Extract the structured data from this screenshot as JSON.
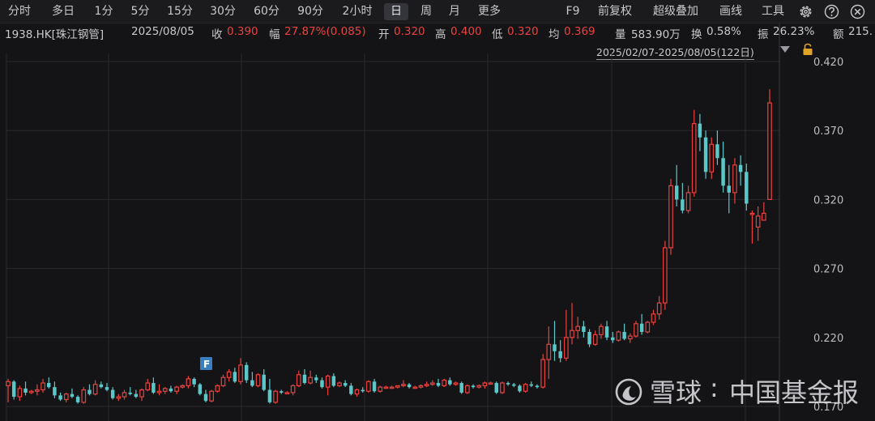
{
  "toolbar": {
    "periods": [
      "分时",
      "多日",
      "1分",
      "5分",
      "15分",
      "30分",
      "60分",
      "90分",
      "2小时",
      "日",
      "周",
      "月",
      "更多"
    ],
    "active_period": "日",
    "right_items": [
      "F9",
      "前复权",
      "超级叠加",
      "画线",
      "工具"
    ],
    "icons": [
      "gear-icon",
      "help-icon",
      "close-icon"
    ]
  },
  "quote": {
    "symbol": "1938.HK[珠江钢管]",
    "date": "2025/08/05",
    "close_label": "收",
    "close": "0.390",
    "change_label": "幅",
    "change": "27.87%(0.085)",
    "open_label": "开",
    "open": "0.320",
    "high_label": "高",
    "high": "0.400",
    "low_label": "低",
    "low": "0.320",
    "avg_label": "均",
    "avg": "0.369",
    "volume_label": "量",
    "volume": "583.90万",
    "turnover_label": "换",
    "turnover": "0.58%",
    "amplitude_label": "振",
    "amplitude": "26.23%",
    "amount_label": "额",
    "amount": "215."
  },
  "range": {
    "label": "2025/02/07-2025/08/05(122日)"
  },
  "chart_data": {
    "type": "candlestick",
    "y_ticks": [
      "0.420",
      "0.370",
      "0.320",
      "0.270",
      "0.220",
      "0.170"
    ],
    "ylim": [
      0.17,
      0.43
    ],
    "num_candles": 122,
    "up_color": "#e8423f",
    "down_color": "#5cc7c9",
    "grid": true,
    "marker_label": "F",
    "candles": [
      [
        0.185,
        0.19,
        0.173,
        0.188
      ],
      [
        0.188,
        0.189,
        0.175,
        0.177
      ],
      [
        0.177,
        0.185,
        0.174,
        0.183
      ],
      [
        0.183,
        0.188,
        0.178,
        0.18
      ],
      [
        0.18,
        0.182,
        0.179,
        0.181
      ],
      [
        0.181,
        0.186,
        0.178,
        0.182
      ],
      [
        0.182,
        0.19,
        0.18,
        0.187
      ],
      [
        0.187,
        0.191,
        0.183,
        0.184
      ],
      [
        0.184,
        0.188,
        0.176,
        0.178
      ],
      [
        0.178,
        0.18,
        0.174,
        0.175
      ],
      [
        0.175,
        0.18,
        0.173,
        0.179
      ],
      [
        0.179,
        0.183,
        0.176,
        0.177
      ],
      [
        0.177,
        0.178,
        0.172,
        0.173
      ],
      [
        0.173,
        0.184,
        0.172,
        0.182
      ],
      [
        0.182,
        0.186,
        0.178,
        0.179
      ],
      [
        0.179,
        0.189,
        0.178,
        0.186
      ],
      [
        0.186,
        0.188,
        0.183,
        0.184
      ],
      [
        0.184,
        0.187,
        0.181,
        0.182
      ],
      [
        0.182,
        0.184,
        0.175,
        0.176
      ],
      [
        0.176,
        0.179,
        0.174,
        0.177
      ],
      [
        0.177,
        0.182,
        0.175,
        0.18
      ],
      [
        0.18,
        0.184,
        0.178,
        0.179
      ],
      [
        0.179,
        0.182,
        0.176,
        0.177
      ],
      [
        0.177,
        0.183,
        0.174,
        0.182
      ],
      [
        0.182,
        0.19,
        0.181,
        0.187
      ],
      [
        0.187,
        0.191,
        0.179,
        0.18
      ],
      [
        0.18,
        0.186,
        0.178,
        0.181
      ],
      [
        0.181,
        0.184,
        0.179,
        0.183
      ],
      [
        0.183,
        0.185,
        0.18,
        0.181
      ],
      [
        0.181,
        0.185,
        0.179,
        0.184
      ],
      [
        0.184,
        0.186,
        0.183,
        0.185
      ],
      [
        0.185,
        0.192,
        0.183,
        0.19
      ],
      [
        0.19,
        0.191,
        0.184,
        0.186
      ],
      [
        0.186,
        0.187,
        0.178,
        0.179
      ],
      [
        0.179,
        0.182,
        0.173,
        0.174
      ],
      [
        0.174,
        0.182,
        0.173,
        0.181
      ],
      [
        0.181,
        0.186,
        0.18,
        0.185
      ],
      [
        0.185,
        0.193,
        0.184,
        0.191
      ],
      [
        0.191,
        0.197,
        0.188,
        0.195
      ],
      [
        0.195,
        0.198,
        0.187,
        0.188
      ],
      [
        0.188,
        0.205,
        0.186,
        0.2
      ],
      [
        0.2,
        0.202,
        0.187,
        0.189
      ],
      [
        0.189,
        0.195,
        0.184,
        0.185
      ],
      [
        0.185,
        0.194,
        0.184,
        0.193
      ],
      [
        0.193,
        0.197,
        0.181,
        0.182
      ],
      [
        0.182,
        0.19,
        0.172,
        0.173
      ],
      [
        0.173,
        0.182,
        0.172,
        0.181
      ],
      [
        0.181,
        0.182,
        0.179,
        0.18
      ],
      [
        0.18,
        0.181,
        0.179,
        0.18
      ],
      [
        0.18,
        0.186,
        0.178,
        0.185
      ],
      [
        0.185,
        0.196,
        0.184,
        0.193
      ],
      [
        0.193,
        0.197,
        0.186,
        0.187
      ],
      [
        0.187,
        0.196,
        0.186,
        0.191
      ],
      [
        0.191,
        0.193,
        0.187,
        0.189
      ],
      [
        0.189,
        0.191,
        0.183,
        0.184
      ],
      [
        0.184,
        0.193,
        0.178,
        0.192
      ],
      [
        0.192,
        0.194,
        0.184,
        0.185
      ],
      [
        0.185,
        0.188,
        0.184,
        0.187
      ],
      [
        0.187,
        0.189,
        0.184,
        0.185
      ],
      [
        0.185,
        0.187,
        0.178,
        0.179
      ],
      [
        0.179,
        0.183,
        0.177,
        0.182
      ],
      [
        0.182,
        0.184,
        0.18,
        0.181
      ],
      [
        0.181,
        0.189,
        0.18,
        0.188
      ],
      [
        0.188,
        0.19,
        0.18,
        0.181
      ],
      [
        0.181,
        0.185,
        0.18,
        0.184
      ],
      [
        0.184,
        0.185,
        0.183,
        0.184
      ],
      [
        0.184,
        0.185,
        0.183,
        0.184
      ],
      [
        0.184,
        0.185,
        0.183,
        0.185
      ],
      [
        0.185,
        0.189,
        0.184,
        0.186
      ],
      [
        0.186,
        0.187,
        0.183,
        0.184
      ],
      [
        0.184,
        0.185,
        0.183,
        0.184
      ],
      [
        0.184,
        0.186,
        0.183,
        0.185
      ],
      [
        0.185,
        0.188,
        0.184,
        0.186
      ],
      [
        0.186,
        0.189,
        0.185,
        0.187
      ],
      [
        0.187,
        0.19,
        0.184,
        0.185
      ],
      [
        0.185,
        0.19,
        0.184,
        0.189
      ],
      [
        0.189,
        0.191,
        0.185,
        0.186
      ],
      [
        0.186,
        0.188,
        0.185,
        0.187
      ],
      [
        0.187,
        0.188,
        0.179,
        0.18
      ],
      [
        0.18,
        0.186,
        0.179,
        0.185
      ],
      [
        0.185,
        0.186,
        0.183,
        0.184
      ],
      [
        0.184,
        0.186,
        0.183,
        0.185
      ],
      [
        0.185,
        0.188,
        0.183,
        0.187
      ],
      [
        0.187,
        0.188,
        0.186,
        0.187
      ],
      [
        0.187,
        0.188,
        0.179,
        0.18
      ],
      [
        0.18,
        0.188,
        0.179,
        0.187
      ],
      [
        0.187,
        0.188,
        0.185,
        0.186
      ],
      [
        0.186,
        0.187,
        0.184,
        0.185
      ],
      [
        0.185,
        0.186,
        0.18,
        0.181
      ],
      [
        0.181,
        0.187,
        0.18,
        0.186
      ],
      [
        0.186,
        0.188,
        0.184,
        0.185
      ],
      [
        0.185,
        0.186,
        0.183,
        0.184
      ],
      [
        0.184,
        0.208,
        0.183,
        0.204
      ],
      [
        0.204,
        0.228,
        0.19,
        0.215
      ],
      [
        0.215,
        0.232,
        0.203,
        0.21
      ],
      [
        0.21,
        0.218,
        0.202,
        0.205
      ],
      [
        0.205,
        0.24,
        0.203,
        0.22
      ],
      [
        0.22,
        0.245,
        0.215,
        0.225
      ],
      [
        0.225,
        0.235,
        0.219,
        0.228
      ],
      [
        0.228,
        0.232,
        0.22,
        0.224
      ],
      [
        0.224,
        0.226,
        0.213,
        0.215
      ],
      [
        0.215,
        0.225,
        0.214,
        0.222
      ],
      [
        0.222,
        0.23,
        0.219,
        0.228
      ],
      [
        0.228,
        0.232,
        0.218,
        0.22
      ],
      [
        0.22,
        0.224,
        0.216,
        0.218
      ],
      [
        0.218,
        0.225,
        0.217,
        0.224
      ],
      [
        0.224,
        0.23,
        0.218,
        0.219
      ],
      [
        0.219,
        0.223,
        0.216,
        0.221
      ],
      [
        0.221,
        0.232,
        0.22,
        0.23
      ],
      [
        0.23,
        0.237,
        0.222,
        0.224
      ],
      [
        0.224,
        0.232,
        0.223,
        0.231
      ],
      [
        0.231,
        0.24,
        0.229,
        0.237
      ],
      [
        0.237,
        0.25,
        0.233,
        0.245
      ],
      [
        0.245,
        0.29,
        0.24,
        0.285
      ],
      [
        0.285,
        0.335,
        0.28,
        0.33
      ],
      [
        0.33,
        0.345,
        0.315,
        0.32
      ],
      [
        0.32,
        0.332,
        0.31,
        0.312
      ],
      [
        0.312,
        0.33,
        0.31,
        0.325
      ],
      [
        0.325,
        0.385,
        0.322,
        0.375
      ],
      [
        0.375,
        0.382,
        0.355,
        0.365
      ],
      [
        0.365,
        0.37,
        0.335,
        0.34
      ],
      [
        0.34,
        0.365,
        0.335,
        0.36
      ],
      [
        0.36,
        0.37,
        0.345,
        0.35
      ],
      [
        0.35,
        0.362,
        0.325,
        0.33
      ],
      [
        0.33,
        0.345,
        0.31,
        0.325
      ],
      [
        0.325,
        0.35,
        0.317,
        0.345
      ],
      [
        0.345,
        0.352,
        0.33,
        0.34
      ],
      [
        0.34,
        0.346,
        0.312,
        0.317
      ],
      [
        0.31,
        0.312,
        0.288,
        0.31
      ],
      [
        0.3,
        0.315,
        0.29,
        0.308
      ],
      [
        0.305,
        0.318,
        0.305,
        0.31
      ],
      [
        0.32,
        0.4,
        0.32,
        0.39
      ]
    ]
  },
  "watermark": {
    "brand": "雪球",
    "separator": ":",
    "source": "中国基金报"
  }
}
